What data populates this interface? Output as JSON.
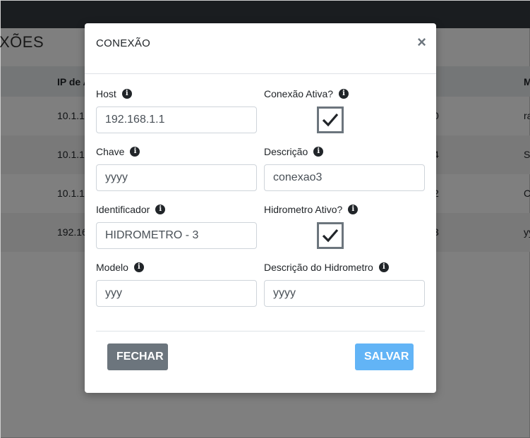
{
  "background": {
    "page_title": "XÕES",
    "table": {
      "headers": [
        "IP de A",
        "",
        "M"
      ],
      "rows": [
        [
          "10.1.1",
          "0",
          "ra"
        ],
        [
          "10.1.1",
          "4",
          "S"
        ],
        [
          "10.1.1",
          "2",
          "C"
        ],
        [
          "192.16",
          "3",
          "yy"
        ]
      ]
    }
  },
  "modal": {
    "title": "CONEXÃO",
    "close_symbol": "×",
    "fields": {
      "host": {
        "label": "Host",
        "value": "192.168.1.1"
      },
      "conexao_ativa": {
        "label": "Conexão Ativa?",
        "checked": true
      },
      "chave": {
        "label": "Chave",
        "value": "yyyy"
      },
      "descricao": {
        "label": "Descrição",
        "value": "conexao3"
      },
      "identificador": {
        "label": "Identificador",
        "value": "HIDROMETRO - 3"
      },
      "hidrometro_ativo": {
        "label": "Hidrometro Ativo?",
        "checked": true
      },
      "modelo": {
        "label": "Modelo",
        "value": "yyy"
      },
      "descricao_hidrometro": {
        "label": "Descrição do Hidrometro",
        "value": "yyyy"
      }
    },
    "info_icon_glyph": "i",
    "buttons": {
      "close_label": "FECHAR",
      "save_label": "SALVAR"
    }
  },
  "colors": {
    "topbar": "#343a40",
    "close_button": "#6c757d",
    "save_button": "#62b4f6"
  }
}
